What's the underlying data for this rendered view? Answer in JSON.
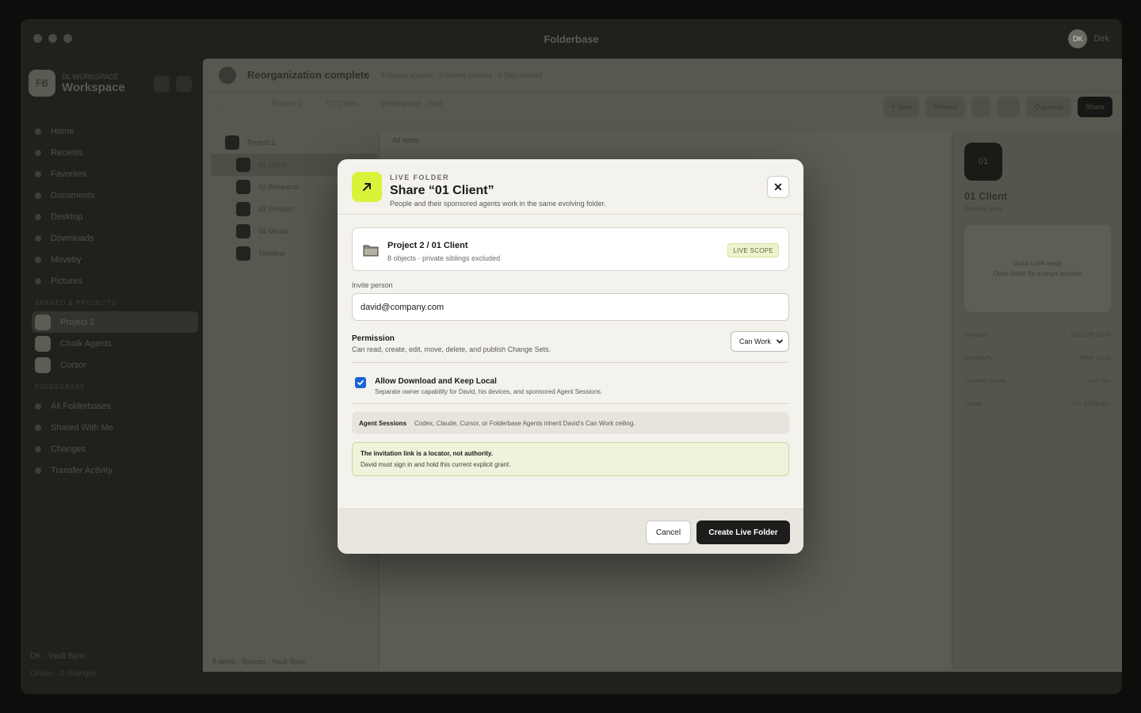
{
  "app": {
    "title": "Folderbase",
    "user_initials": "DK",
    "user_name": "Dirk"
  },
  "workspace": {
    "sub": "DL WORKSPACE",
    "name": "Workspace",
    "logo": "FB"
  },
  "sidebar": {
    "nav": [
      "Home",
      "Recents",
      "Favorites",
      "Documents",
      "Desktop",
      "Downloads",
      "Moveby",
      "Pictures"
    ],
    "section_projects": "SHARED & PROJECTS",
    "projects": [
      "Project 2",
      "Chalk Agents",
      "Cursor"
    ],
    "section_views": "FOLDERBASE",
    "views": [
      "All Folderbases",
      "Shared With Me",
      "Changes",
      "Transfer Activity"
    ],
    "footer": "DK · Vault Sync",
    "footer2": "Online · 2 changes"
  },
  "main": {
    "banner_title": "Reorganization complete",
    "banner_meta": "8 moves applied · 0 folders created · 0 files deleted",
    "crumbs": [
      "Project 2",
      "01 Client",
      "Workspace · root"
    ],
    "toolbar": [
      "+ New",
      "Review",
      "↓",
      "⋯",
      "Organize",
      "Share"
    ],
    "tree": [
      "Project 2",
      "01 Client",
      "02 Research",
      "03 Product",
      "04 Media",
      "Timeline"
    ],
    "pane_head": "All items",
    "status": "8 items · Synced · Vault Sync"
  },
  "inspector": {
    "icon": "01",
    "title": "01 Client",
    "sub": "Working local",
    "card_title": "Quick Look ready",
    "card_sub": "Open folder for a larger preview",
    "rows": [
      {
        "k": "Created",
        "v": "Oct 12th 2024"
      },
      {
        "k": "Sensitivity",
        "v": "Work Local"
      },
      {
        "k": "Content scope",
        "v": "Live Set"
      },
      {
        "k": "Owner",
        "v": "DK (Defaults)"
      }
    ]
  },
  "modal": {
    "kicker": "LIVE FOLDER",
    "title": "Share “01 Client”",
    "desc": "People and their sponsored agents work in the same evolving folder.",
    "close_glyph": "✕",
    "scope": {
      "title": "Project 2 / 01 Client",
      "meta": "8 objects · private siblings excluded",
      "badge": "LIVE SCOPE"
    },
    "invite_label": "Invite person",
    "invite_value": "david@company.com",
    "permission_label": "Permission",
    "permission_desc": "Can read, create, edit, move, delete, and publish Change Sets.",
    "permission_value": "Can Work",
    "download_label": "Allow Download and Keep Local",
    "download_desc": "Separate owner capability for David, his devices, and sponsored Agent Sessions.",
    "download_checked": true,
    "agent_key": "Agent Sessions",
    "agent_value": "Codex, Claude, Cursor, or Folderbase Agents inherit David’s Can Work ceiling.",
    "note_title": "The invitation link is a locator, not authority.",
    "note_desc": "David must sign in and hold this current explicit grant.",
    "cancel_label": "Cancel",
    "create_label": "Create Live Folder"
  },
  "colors": {
    "accent": "#d9f23a",
    "checkbox": "#1a63d8",
    "primary_button": "#1d1d1b"
  }
}
